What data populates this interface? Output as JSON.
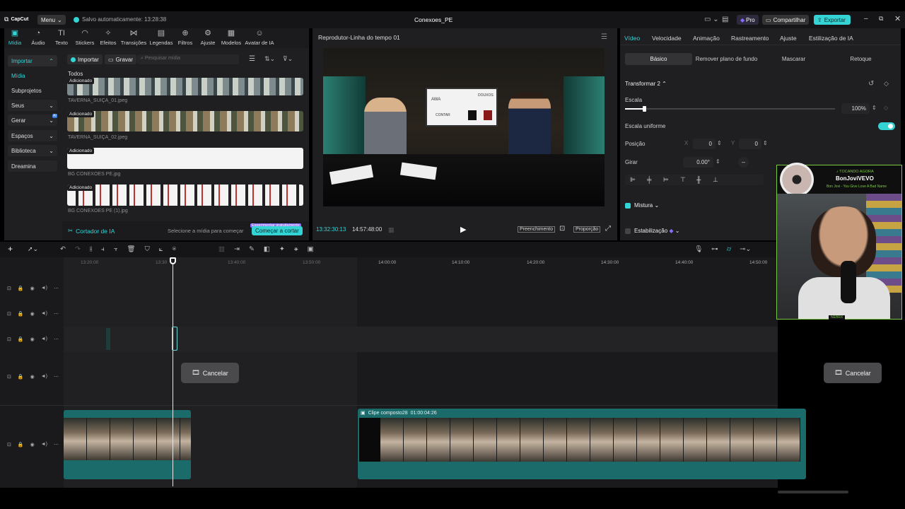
{
  "topbar": {
    "logo": "CapCut",
    "menu": "Menu",
    "autosave": "Salvo automaticamente: 13:28:38",
    "project_title": "Conexoes_PE",
    "pro": "Pro",
    "share": "Compartilhar",
    "export": "Exportar"
  },
  "media_tabs": [
    "Mídia",
    "Áudio",
    "Texto",
    "Stickers",
    "Efeitos",
    "Transições",
    "Legendas",
    "Filtros",
    "Ajuste",
    "Modelos",
    "Avatar de IA"
  ],
  "left_nav": {
    "import": "Importar",
    "items": [
      "Mídia",
      "Subprojetos",
      "Seus",
      "Gerar",
      "Espaços",
      "Biblioteca",
      "Dreamina"
    ],
    "gerar_badge": "AI"
  },
  "media_toolbar": {
    "import": "Importar",
    "record": "Gravar",
    "search_placeholder": "Pesquisar mídia"
  },
  "media": {
    "section": "Todos",
    "items": [
      {
        "tag": "Adicionado",
        "name": "TAVERNA_SUIÇA_01.jpeg"
      },
      {
        "tag": "Adicionado",
        "name": "TAVERNA_SUIÇA_02.jpeg"
      },
      {
        "tag": "Adicionado",
        "name": "BG CONEXOES PE.jpg"
      },
      {
        "tag": "Adicionado",
        "name": "BG CONEXOES PE (1).jpg"
      }
    ]
  },
  "ai_cutter": {
    "label": "Cortador de IA",
    "hint": "Selecione a mídia para começar",
    "badge": "Experimentar gratuitamente",
    "button": "Começar a cortar"
  },
  "player": {
    "title": "Reprodutor-Linha do tempo 01",
    "current_time": "13:32:30:13",
    "total_time": "14:57:48:00",
    "fill": "Preenchimento",
    "ratio": "Proporção",
    "screen_text": [
      "AWA",
      "CONTAR",
      "DOUXOS"
    ]
  },
  "right_tabs": [
    "Vídeo",
    "Velocidade",
    "Animação",
    "Rastreamento",
    "Ajuste",
    "Estilização de IA"
  ],
  "right_subtabs": [
    "Básico",
    "Remover plano de fundo",
    "Mascarar",
    "Retoque"
  ],
  "properties": {
    "transform": "Transformar 2",
    "scale_label": "Escala",
    "scale_value": "100%",
    "scale_fraction": 0.09,
    "uniform_scale": "Escala uniforme",
    "position_label": "Posição",
    "pos_x_label": "X",
    "pos_x": "0",
    "pos_y_label": "Y",
    "pos_y": "0",
    "rotate_label": "Girar",
    "rotate_value": "0.00°",
    "blend": "Mistura",
    "stabilize": "Estabilização"
  },
  "webcam": {
    "now_playing": "♪ TOCANDO AGORA",
    "artist": "BonJoviVEVO",
    "song": "Bon Jovi - You Give Love A Bad Name",
    "footer": "NEBRX"
  },
  "timeline": {
    "ticks": [
      "13:20:00",
      "13:30",
      "13:40:00",
      "13:50:00",
      "14:00:00",
      "14:10:00",
      "14:20:00",
      "14:30:00",
      "14:40:00",
      "14:50:00"
    ],
    "cancel": "Cancelar",
    "clip_name": "Clipe composto28",
    "clip_duration": "01:00:04:26"
  },
  "colors": {
    "accent": "#34d3d4",
    "pro": "#8b6cff",
    "clip": "#1a6b6a"
  }
}
